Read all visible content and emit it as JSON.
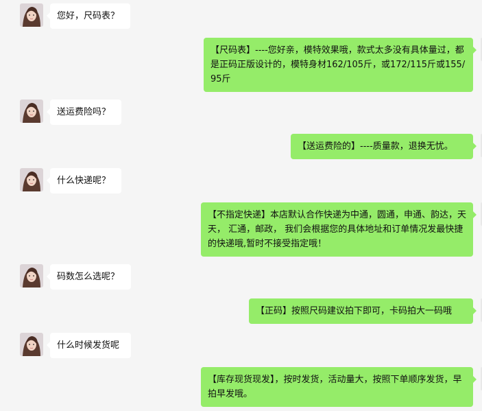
{
  "messages": [
    {
      "side": "left",
      "text": "您好，尺码表？"
    },
    {
      "side": "right",
      "text": "【尺码表】----您好亲，模特效果哦，款式太多没有具体量过，都是正码正版设计的，模特身材162/105斤，或172/115斤或155/95斤"
    },
    {
      "side": "left",
      "text": "送运费险吗？"
    },
    {
      "side": "right",
      "text": "【送运费险的】----质量款，退换无忧。"
    },
    {
      "side": "left",
      "text": "什么快递呢？"
    },
    {
      "side": "right",
      "text": "【不指定快递】本店默认合作快递为中通，圆通，申通、韵达，天天， 汇通，邮政， 我们会根据您的具体地址和订单情况发最快捷的快递哦,暂时不接受指定哦！"
    },
    {
      "side": "left",
      "text": "码数怎么选呢？"
    },
    {
      "side": "right",
      "text": "【正码】按照尺码建议拍下即可，卡码拍大一码哦"
    },
    {
      "side": "left",
      "text": "什么时候发货呢"
    },
    {
      "side": "right",
      "text": "【库存现货现发】，按时发货，活动量大，按照下单顺序发货，早拍早发哦。"
    }
  ]
}
